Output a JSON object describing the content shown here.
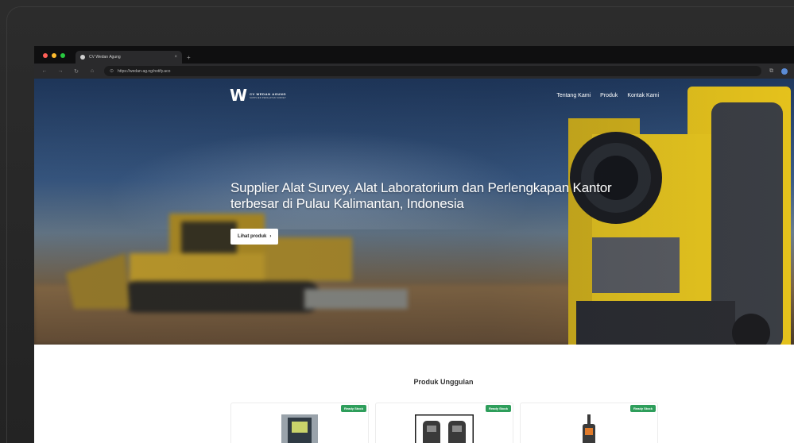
{
  "browser": {
    "tab_title": "CV Wedan Agung",
    "tab_close": "×",
    "new_tab": "+",
    "url": "https://wedan-ag.ng/notify.aco"
  },
  "site": {
    "logo_mark": "W",
    "logo_name": "CV WEDAN AGUNG",
    "logo_sub": "SUPPLIER PERALATAN SURVEY",
    "menu": [
      "Tentang Kami",
      "Produk",
      "Kontak Kami"
    ]
  },
  "hero": {
    "title": "Supplier Alat Survey, Alat Laboratorium dan Perlengkapan Kantor terbesar di Pulau Kalimantan, Indonesia",
    "button_label": "Lihat produk",
    "button_arrow": "›"
  },
  "products": {
    "section_title": "Produk Unggulan",
    "items": [
      {
        "badge": "Ready Stock",
        "icon": "gps-device-icon"
      },
      {
        "badge": "Ready Stock",
        "icon": "radio-pair-icon"
      },
      {
        "badge": "Ready Stock",
        "icon": "handheld-gps-icon"
      }
    ]
  },
  "colors": {
    "badge": "#2e9e5b",
    "instrument_yellow": "#e5c21c",
    "tab_bar": "#0f0f10"
  }
}
